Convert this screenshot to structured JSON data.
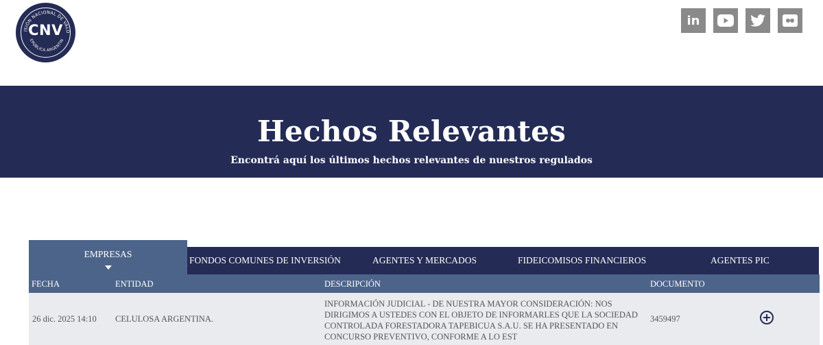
{
  "logo": {
    "text": "CNV",
    "ring_top": "COMISIÓN NACIONAL DE VALORES",
    "ring_bottom": "REPÚBLICA ARGENTINA"
  },
  "social": [
    {
      "name": "linkedin",
      "label": "in"
    },
    {
      "name": "youtube",
      "label": ""
    },
    {
      "name": "twitter",
      "label": ""
    },
    {
      "name": "flickr",
      "label": ""
    }
  ],
  "hero": {
    "title": "Hechos Relevantes",
    "subtitle": "Encontrá aquí los últimos hechos relevantes de nuestros regulados"
  },
  "tabs": {
    "active": "EMPRESAS",
    "items": [
      "FONDOS COMUNES DE INVERSIÓN",
      "AGENTES Y MERCADOS",
      "FIDEICOMISOS FINANCIEROS",
      "AGENTES PIC"
    ]
  },
  "table": {
    "headers": {
      "fecha": "FECHA",
      "entidad": "ENTIDAD",
      "descripcion": "DESCRIPCIÓN",
      "documento": "DOCUMENTO"
    },
    "rows": [
      {
        "fecha": "26 dic. 2025 14:10",
        "entidad": "CELULOSA ARGENTINA.",
        "descripcion": "INFORMACIÓN JUDICIAL - DE NUESTRA MAYOR CONSIDERACIÓN: NOS DIRIGIMOS A USTEDES CON EL OBJETO DE INFORMARLES QUE LA SOCIEDAD CONTROLADA FORESTADORA TAPEBICUA S.A.U. SE HA PRESENTADO EN CONCURSO PREVENTIVO, CONFORME A LO EST",
        "documento": "3459497"
      }
    ]
  },
  "colors": {
    "navy": "#242b55",
    "tab_active": "#4c6489",
    "row_bg": "#e9ebee",
    "social_bg": "#8a8a8a"
  }
}
